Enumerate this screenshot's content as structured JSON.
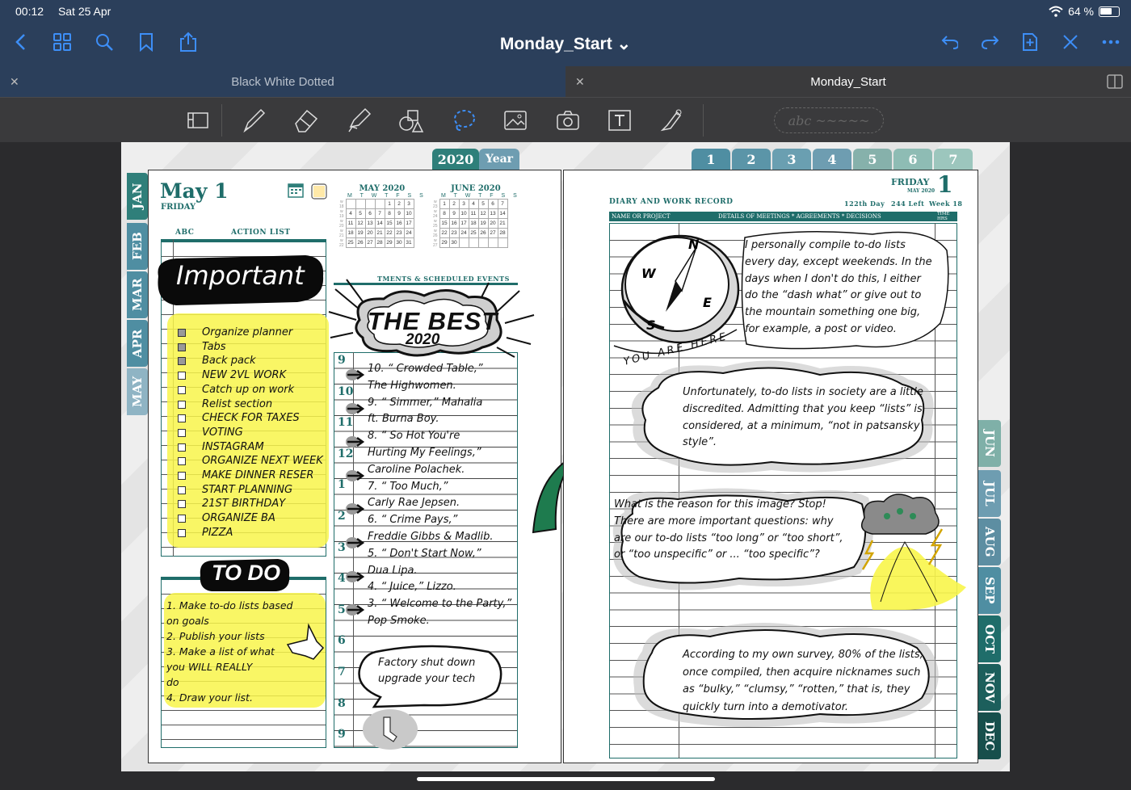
{
  "status": {
    "time": "00:12",
    "date": "Sat 25 Apr",
    "battery": "64 %"
  },
  "nav": {
    "title": "Monday_Start ⌄"
  },
  "tabs": [
    {
      "label": "Black White Dotted"
    },
    {
      "label": "Monday_Start"
    }
  ],
  "toolbar": {
    "text_placeholder": "abc ~~~~~"
  },
  "planner": {
    "year_tab": "2020",
    "year_label": "Year",
    "day_tabs": [
      "1",
      "2",
      "3",
      "4",
      "5",
      "6",
      "7"
    ],
    "months_left": [
      "JAN",
      "FEB",
      "MAR",
      "APR",
      "MAY"
    ],
    "months_right": [
      "JUN",
      "JUL",
      "AUG",
      "SEP",
      "OCT",
      "NOV",
      "DEC"
    ],
    "left": {
      "date": "May 1",
      "weekday": "FRIDAY",
      "col_abc": "ABC",
      "col_action": "ACTION LIST",
      "cal1_title": "MAY 2020",
      "cal2_title": "JUNE 2020",
      "cal_days": "M T W T F S S",
      "important": "Important",
      "action_items": [
        "Organize planner",
        "Tabs",
        "Back pack",
        "NEW 2VL WORK",
        "Catch up on work",
        "Relist section",
        "CHECK FOR TAXES",
        "VOTING",
        "INSTAGRAM",
        "ORGANIZE NEXT WEEK",
        "MAKE DINNER RESER",
        "START PLANNING",
        "21ST BIRTHDAY",
        "ORGANIZE BA",
        "PIZZA"
      ],
      "todo_title": "TO DO",
      "todo_lines": [
        "1. Make to-do lists based",
        "on goals",
        "2. Publish your lists",
        "3. Make a list of what",
        "you WILL REALLY",
        "do",
        "4. Draw your list."
      ],
      "appt_header": "TMENTS & SCHEDULED EVENTS",
      "best_title": "THE BEST",
      "best_year": "2020",
      "hours": [
        "9",
        "10",
        "11",
        "12",
        "1",
        "2",
        "3",
        "4",
        "5",
        "6",
        "7",
        "8",
        "9"
      ],
      "songs": [
        "10. “ Crowded Table,”",
        "The Highwomen.",
        "9. “ Simmer,” Mahalia",
        "ft. Burna Boy.",
        "8. “ So Hot You're",
        "Hurting My Feelings,”",
        "Caroline Polachek.",
        "7. “ Too Much,”",
        "Carly Rae Jepsen.",
        "6. “ Crime Pays,”",
        "Freddie Gibbs & Madlib.",
        "5. “ Don't Start Now,”",
        "Dua Lipa.",
        "4. “ Juice,” Lizzo.",
        "3. “ Welcome to the Party,”",
        "Pop Smoke."
      ],
      "bubble": [
        "Factory shut down",
        "upgrade your tech"
      ]
    },
    "right": {
      "weekday": "FRIDAY",
      "month_year": "MAY 2020",
      "day_number": "1",
      "section_title": "DIARY AND WORK RECORD",
      "day_of_year": "122th Day",
      "days_left": "244 Left",
      "week": "Week 18",
      "col_name": "NAME OR PROJECT",
      "col_details": "DETAILS OF MEETINGS * AGREEMENTS * DECISIONS",
      "col_time": "TIME HRS",
      "compass_caption": "YOU ARE HERE",
      "para1": "I personally compile to-do lists every day, except weekends. In the days when I don't do this, I either do the “dash what” or give out to the mountain something one big, for example, a post or video.",
      "para2": "Unfortunately, to-do lists in society are a little discredited. Admitting that you keep “lists” is considered, at a minimum, “not in patsansky style”.",
      "para3": "What is the reason for this image? Stop! There are more important questions: why are our to-do lists “too long” or “too short”, or “too unspecific” or ... “too specific”?",
      "para4": "According to my own survey, 80% of the lists, once compiled, then acquire nicknames such as “bulky,” “clumsy,” “rotten,” that is, they quickly turn into a demotivator."
    }
  }
}
